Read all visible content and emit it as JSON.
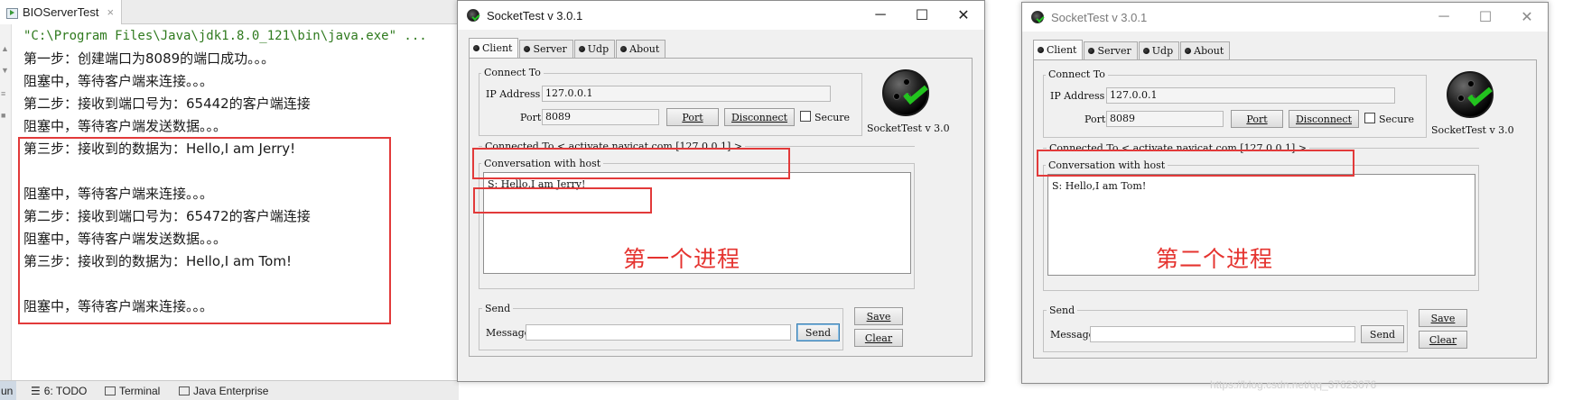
{
  "ide": {
    "tab_title": "BIOServerTest",
    "console_lines": [
      "\"C:\\Program Files\\Java\\jdk1.8.0_121\\bin\\java.exe\" ...",
      "第一步：创建端口为8089的端口成功。。。",
      "阻塞中，等待客户端来连接。。。",
      "第二步：接收到端口号为：65442的客户端连接",
      "阻塞中，等待客户端发送数据。。。",
      "第三步：接收到的数据为：Hello,I am Jerry!",
      "",
      "阻塞中，等待客户端来连接。。。",
      "第二步：接收到端口号为：65472的客户端连接",
      "阻塞中，等待客户端发送数据。。。",
      "第三步：接收到的数据为：Hello,I am Tom!",
      "",
      "阻塞中，等待客户端来连接。。。"
    ],
    "bottom_tabs": {
      "run_stub": "un",
      "todo": "6: TODO",
      "terminal": "Terminal",
      "java_enterprise": "Java Enterprise"
    }
  },
  "windows": [
    {
      "title": "SocketTest v 3.0.1",
      "tabs": [
        "Client",
        "Server",
        "Udp",
        "About"
      ],
      "connect_group": "Connect To",
      "ip_label": "IP Address",
      "ip_value": "127.0.0.1",
      "port_label": "Port",
      "port_value": "8089",
      "port_button": "Port",
      "disconnect_button": "Disconnect",
      "secure_label": "Secure",
      "logo_text": "SocketTest v 3.0",
      "connected_to": "Connected To <  activate.navicat.com [127.0.0.1]  >",
      "conversation_label": "Conversation with host",
      "conversation_message": "S: Hello,I am Jerry!",
      "overlay_label": "第一个进程",
      "send_group": "Send",
      "message_label": "Message",
      "message_value": "",
      "send_button": "Send",
      "save_button": "Save",
      "clear_button": "Clear"
    },
    {
      "title": "SocketTest v 3.0.1",
      "tabs": [
        "Client",
        "Server",
        "Udp",
        "About"
      ],
      "connect_group": "Connect To",
      "ip_label": "IP Address",
      "ip_value": "127.0.0.1",
      "port_label": "Port",
      "port_value": "8089",
      "port_button": "Port",
      "disconnect_button": "Disconnect",
      "secure_label": "Secure",
      "logo_text": "SocketTest v 3.0",
      "connected_to": "Connected To <  activate.navicat.com [127.0.0.1]  >",
      "conversation_label": "Conversation with host",
      "conversation_message": "S: Hello,I am Tom!",
      "overlay_label": "第二个进程",
      "send_group": "Send",
      "message_label": "Message",
      "message_value": "",
      "send_button": "Send",
      "save_button": "Save",
      "clear_button": "Clear"
    }
  ],
  "watermark": "https://blog.csdn.net/qq_37623076",
  "colors": {
    "annotation_red": "#e23a3a",
    "console_command_green": "#2f7a1e",
    "logo_check_green": "#22c31e"
  }
}
